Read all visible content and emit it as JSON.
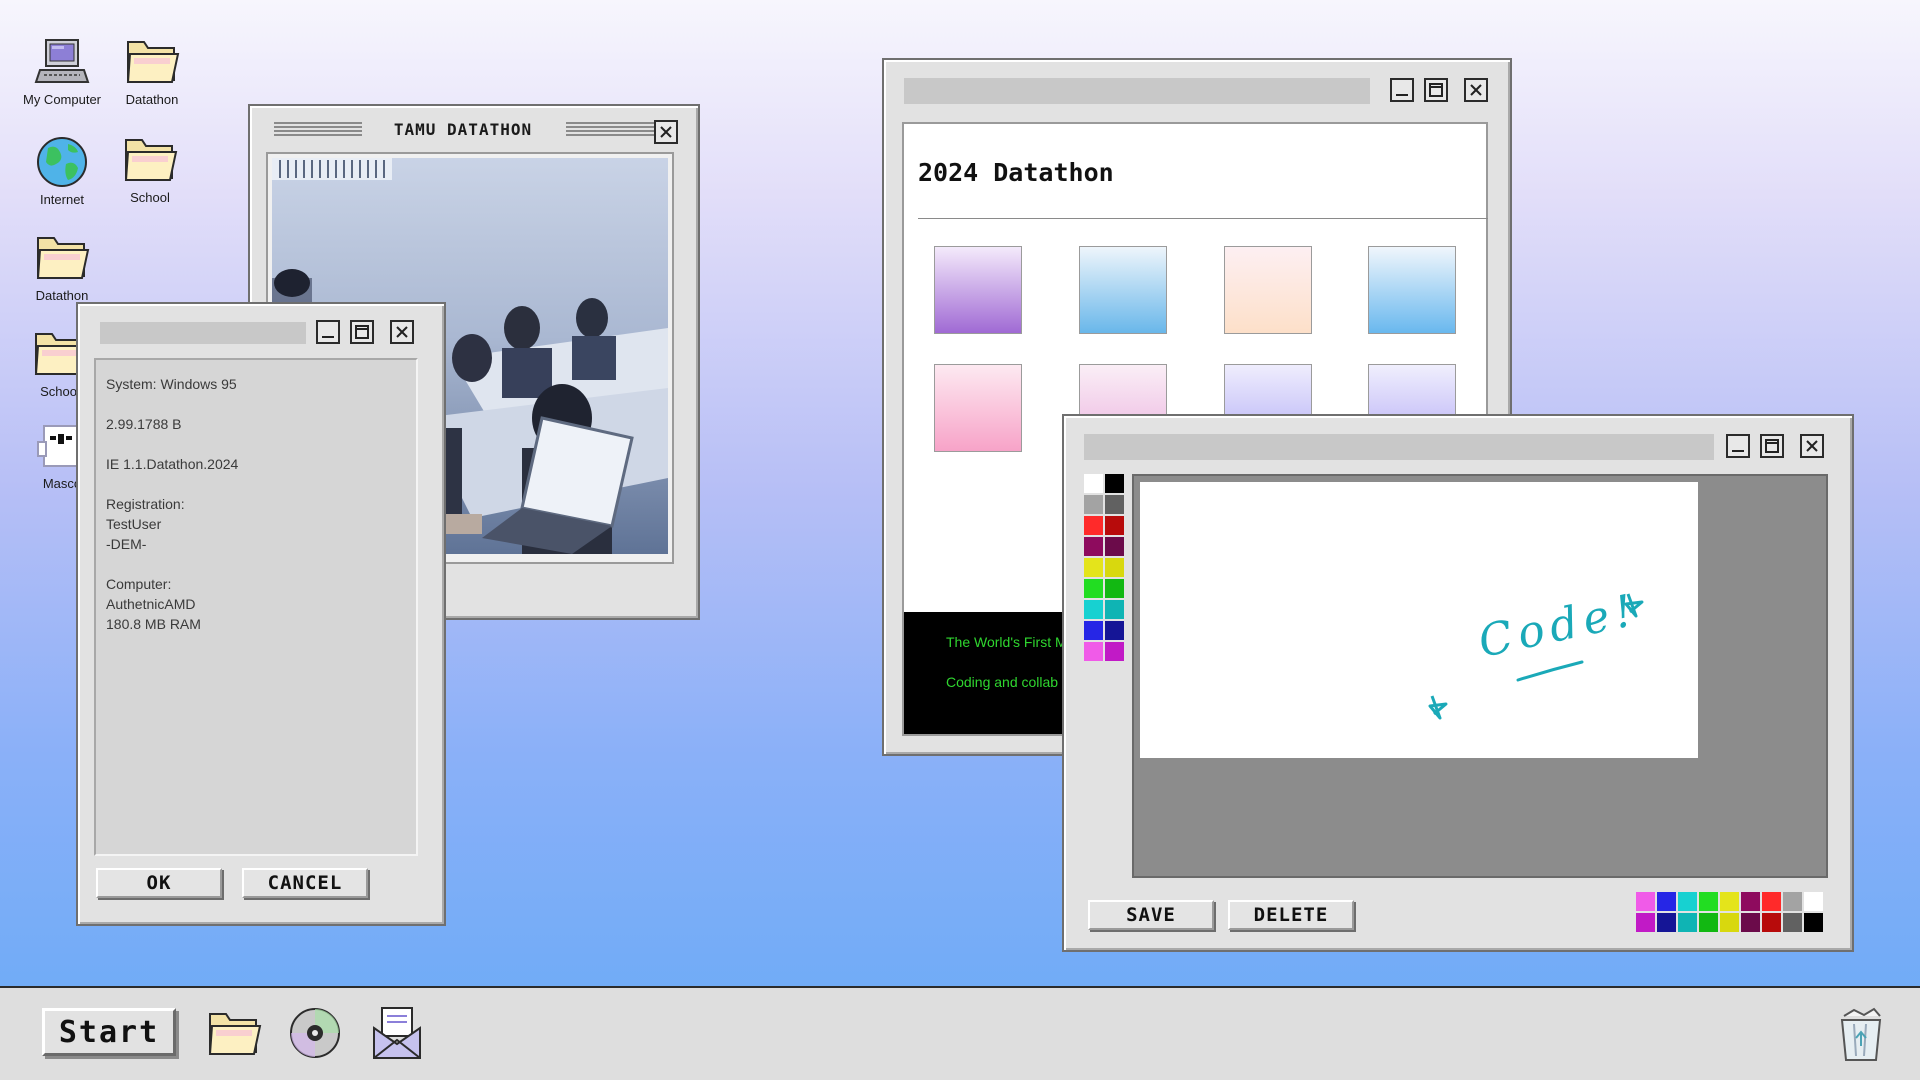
{
  "desktop": {
    "icons": [
      {
        "label": "My Computer",
        "icon": "computer-icon"
      },
      {
        "label": "Datathon",
        "icon": "folder-icon"
      },
      {
        "label": "Internet",
        "icon": "globe-icon"
      },
      {
        "label": "School",
        "icon": "folder-icon"
      },
      {
        "label": "Datathon",
        "icon": "folder-icon"
      },
      {
        "label": "School",
        "icon": "folder-icon"
      },
      {
        "label": "Masco",
        "icon": "mascot-icon"
      }
    ]
  },
  "photo_window": {
    "title": "TAMU DATATHON"
  },
  "system_window": {
    "lines": [
      "System: Windows 95",
      "2.99.1788 B",
      "IE 1.1.Datathon.2024",
      "Registration:\nTestUser\n-DEM-",
      "Computer:\nAuthetnicAMD\n180.8 MB RAM"
    ],
    "ok_label": "OK",
    "cancel_label": "CANCEL"
  },
  "datathon_window": {
    "heading": "2024 Datathon",
    "footer_line1": "The World's First M",
    "footer_line2": "Coding and collab",
    "swatches": [
      [
        "#f4eafb",
        "#a06ad4"
      ],
      [
        "#eef5fb",
        "#69b7ea"
      ],
      [
        "#fdeff2",
        "#fde0c9"
      ],
      [
        "#f0f6fc",
        "#69b8ee"
      ],
      [
        "#fde9f1",
        "#f7a3c8"
      ],
      [
        "#faeef6",
        "#ecb4e0"
      ],
      [
        "#efedfd",
        "#b3aef6"
      ],
      [
        "#f0effd",
        "#b5acf6"
      ]
    ]
  },
  "paint_window": {
    "canvas_text": "Code!",
    "save_label": "SAVE",
    "delete_label": "DELETE",
    "side_palette": [
      [
        "#ffffff",
        "#000000"
      ],
      [
        "#a3a3a3",
        "#616161"
      ],
      [
        "#ff2a2a",
        "#b70b0b"
      ],
      [
        "#8e0b5e",
        "#6b0b4a"
      ],
      [
        "#e4e41b",
        "#d8d80e"
      ],
      [
        "#22dd22",
        "#12b812"
      ],
      [
        "#17d1d1",
        "#0fb4b4"
      ],
      [
        "#2626e6",
        "#151596"
      ],
      [
        "#f05be8",
        "#c11ac6"
      ]
    ],
    "bottom_palette_top": [
      "#f05be8",
      "#2626e6",
      "#17d1d1",
      "#22dd22",
      "#e4e41b",
      "#8e0b5e",
      "#ff2a2a",
      "#a3a3a3",
      "#ffffff"
    ],
    "bottom_palette_bottom": [
      "#c11ac6",
      "#151596",
      "#0fb4b4",
      "#12b812",
      "#d8d80e",
      "#6b0b4a",
      "#b70b0b",
      "#616161",
      "#000000"
    ],
    "ink_color": "#1aa9b8"
  },
  "taskbar": {
    "start_label": "Start",
    "items": [
      "folder-icon",
      "cd-icon",
      "mail-icon"
    ],
    "tray": "recycle-bin-icon"
  }
}
